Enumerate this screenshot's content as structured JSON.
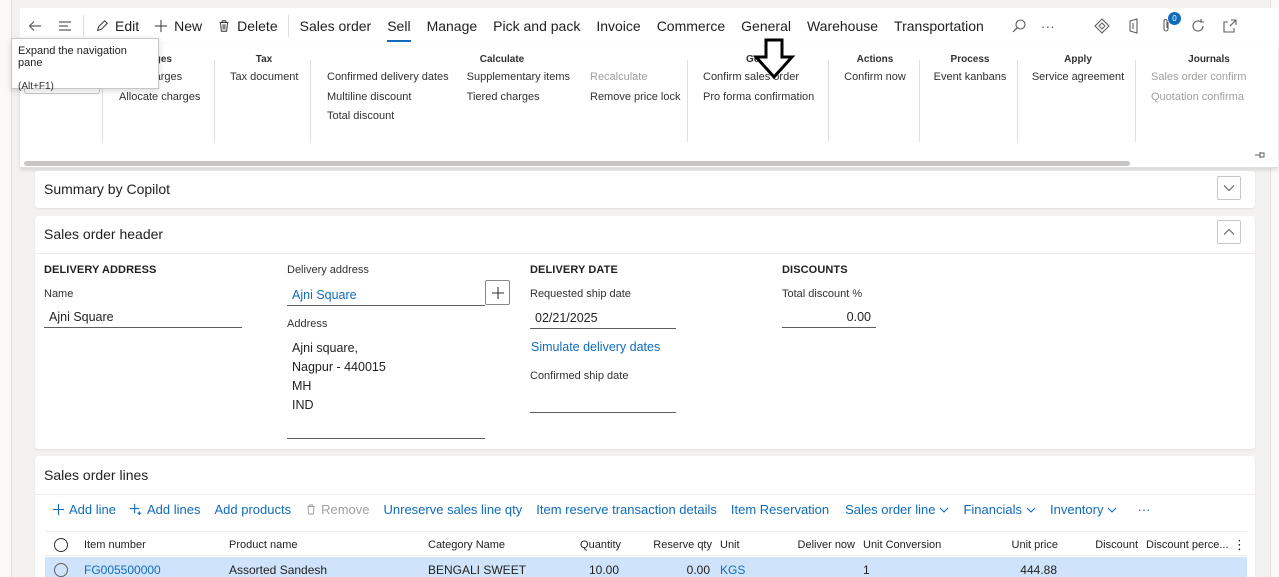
{
  "commandbar": {
    "edit_label": "Edit",
    "new_label": "New",
    "delete_label": "Delete",
    "tabs": [
      "Sales order",
      "Sell",
      "Manage",
      "Pick and pack",
      "Invoice",
      "Commerce",
      "General",
      "Warehouse",
      "Transportation"
    ],
    "active_tab": "Sell",
    "more": "···",
    "notification_count": "0"
  },
  "tooltip": {
    "title": "Expand the navigation pane",
    "shortcut": "(Alt+F1)"
  },
  "ribbon": {
    "groups": [
      {
        "title": "Charges",
        "title_visible": "rges",
        "items": [
          "Maintain charges",
          "Allocate charges"
        ],
        "items_visible": [
          "charges",
          "Allocate charges"
        ]
      },
      {
        "title": "Tax",
        "items": [
          "Tax document"
        ]
      },
      {
        "title": "Calculate",
        "col1": [
          "Confirmed delivery dates",
          "Multiline discount",
          "Total discount"
        ],
        "col2": [
          "Supplementary items",
          "Tiered charges"
        ],
        "col3": [
          "Recalculate",
          "Remove price lock"
        ]
      },
      {
        "title": "Generate",
        "title_visible": "Ge      te",
        "items": [
          "Confirm sales order",
          "Pro forma confirmation"
        ]
      },
      {
        "title": "Actions",
        "items": [
          "Confirm now"
        ]
      },
      {
        "title": "Process",
        "items": [
          "Event kanbans"
        ]
      },
      {
        "title": "Apply",
        "items": [
          "Service agreement"
        ]
      },
      {
        "title": "Journals",
        "items": [
          "Sales order confirm",
          "Quotation confirma"
        ]
      }
    ]
  },
  "summary": {
    "title": "Summary by Copilot"
  },
  "header": {
    "title": "Sales order header",
    "delivery_address_section": "DELIVERY ADDRESS",
    "name_label": "Name",
    "name_value": "Ajni Square",
    "delivery_address_label": "Delivery address",
    "delivery_address_value": "Ajni Square",
    "address_label": "Address",
    "address_lines": [
      "Ajni square,",
      "Nagpur - 440015",
      "MH",
      "IND"
    ],
    "delivery_date_section": "DELIVERY DATE",
    "requested_ship_label": "Requested ship date",
    "requested_ship_value": "02/21/2025",
    "simulate_link": "Simulate delivery dates",
    "confirmed_ship_label": "Confirmed ship date",
    "discounts_section": "DISCOUNTS",
    "total_discount_label": "Total discount %",
    "total_discount_value": "0.00"
  },
  "lines": {
    "title": "Sales order lines",
    "toolbar": {
      "add_line": "Add line",
      "add_lines": "Add lines",
      "add_products": "Add products",
      "remove": "Remove",
      "unreserve": "Unreserve sales line qty",
      "item_reserve_details": "Item reserve transaction details",
      "item_reservation": "Item Reservation",
      "sales_order_line": "Sales order line",
      "financials": "Financials",
      "inventory": "Inventory",
      "more": "···"
    },
    "columns": [
      "Item number",
      "Product name",
      "Category Name",
      "Quantity",
      "Reserve qty",
      "Unit",
      "Deliver now",
      "Unit Conversion",
      "Unit price",
      "Discount",
      "Discount perce..."
    ],
    "rows": [
      {
        "item_number": "FG005500000",
        "product_name": "Assorted Sandesh",
        "category": "BENGALI SWEET",
        "quantity": "10.00",
        "reserve_qty": "0.00",
        "unit": "KGS",
        "deliver_now": "",
        "unit_conversion": "1",
        "unit_price": "444.88",
        "discount": "",
        "discount_pct": ""
      }
    ]
  }
}
